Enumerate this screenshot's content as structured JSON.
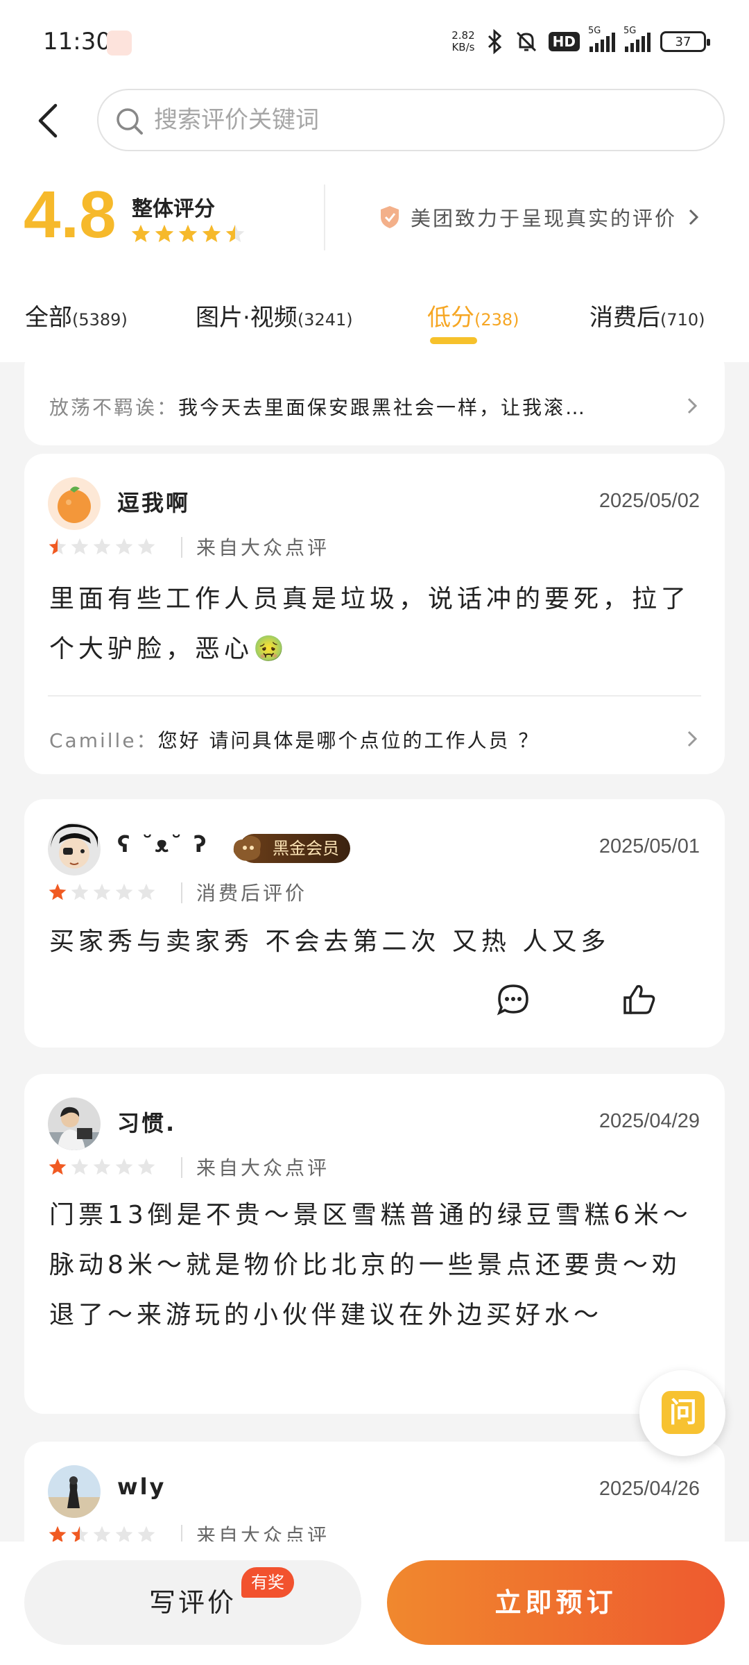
{
  "status_bar": {
    "time": "11:30",
    "net_speed_value": "2.82",
    "net_speed_unit": "KB/s",
    "hd_label": "HD",
    "signal_1": "5G",
    "signal_2": "5G",
    "battery": "37"
  },
  "search": {
    "placeholder": "搜索评价关键词"
  },
  "summary": {
    "score": "4.8",
    "label": "整体评分",
    "stars": 4.5,
    "promise": "美团致力于呈现真实的评价"
  },
  "tabs": [
    {
      "label": "全部",
      "count": "(5389)"
    },
    {
      "label": "图片·视频",
      "count": "(3241)"
    },
    {
      "label": "低分",
      "count": "(238)"
    },
    {
      "label": "消费后",
      "count": "(710)"
    }
  ],
  "active_tab": "低分",
  "top_reply": {
    "author": "放荡不羁诶：",
    "text": "我今天去里面保安跟黑社会一样，让我滚…"
  },
  "reviews": [
    {
      "user": "逗我啊",
      "date": "2025/05/02",
      "rating": 0.5,
      "source": "来自大众点评",
      "text": "里面有些工作人员真是垃圾，说话冲的要死，拉了个大驴脸，恶心🤢",
      "reply_author": "Camille：",
      "reply_text": "您好 请问具体是哪个点位的工作人员 ？"
    },
    {
      "user": "ʕ ˘ᴥ˘ ʔ",
      "badge": "黑金会员",
      "date": "2025/05/01",
      "rating": 1,
      "source": "消费后评价",
      "text": "买家秀与卖家秀  不会去第二次  又热  人又多"
    },
    {
      "user": "习惯.",
      "date": "2025/04/29",
      "rating": 1,
      "source": "来自大众点评",
      "text": "门票13倒是不贵～景区雪糕普通的绿豆雪糕6米～脉动8米～就是物价比北京的一些景点还要贵～劝退了～来游玩的小伙伴建议在外边买好水～"
    },
    {
      "user": "wly",
      "date": "2025/04/26",
      "rating": 1.5,
      "source": "来自大众点评"
    }
  ],
  "ask_button": "问",
  "bottom": {
    "write_label": "写评价",
    "reward_label": "有奖",
    "book_label": "立即预订"
  },
  "colors": {
    "score": "#f6b92b",
    "active_tab": "#f6a623",
    "star_on": "#f05a22",
    "book_button": "#ee5a2f"
  }
}
